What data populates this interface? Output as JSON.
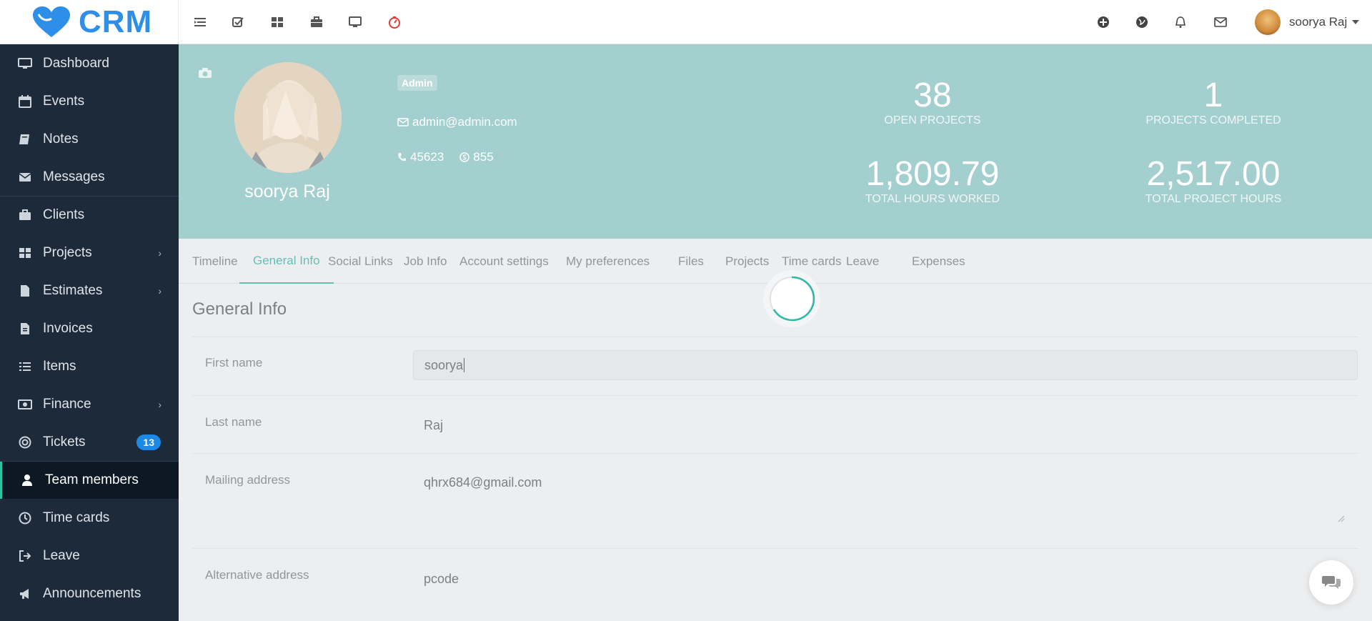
{
  "app": {
    "logo_text": "CRM"
  },
  "topbar": {
    "left_icons": [
      "menu-toggle-icon",
      "todo-checkbox-icon",
      "dashboard-grid-icon",
      "briefcase-icon",
      "monitor-icon",
      "timer-clock-icon"
    ],
    "right_icons": [
      "add-plus-icon",
      "globe-icon",
      "bell-icon",
      "envelope-icon"
    ],
    "user_name": "soorya Raj"
  },
  "sidebar": {
    "items": [
      {
        "label": "Dashboard",
        "icon": "monitor-icon"
      },
      {
        "label": "Events",
        "icon": "calendar-icon"
      },
      {
        "label": "Notes",
        "icon": "book-icon"
      },
      {
        "label": "Messages",
        "icon": "envelope-icon"
      },
      {
        "label": "Clients",
        "icon": "briefcase-icon"
      },
      {
        "label": "Projects",
        "icon": "grid-icon",
        "has_submenu": true
      },
      {
        "label": "Estimates",
        "icon": "file-icon",
        "has_submenu": true
      },
      {
        "label": "Invoices",
        "icon": "file-text-icon"
      },
      {
        "label": "Items",
        "icon": "list-icon"
      },
      {
        "label": "Finance",
        "icon": "money-icon",
        "has_submenu": true
      },
      {
        "label": "Tickets",
        "icon": "life-ring-icon",
        "badge": "13"
      },
      {
        "label": "Team members",
        "icon": "user-icon",
        "active": true
      },
      {
        "label": "Time cards",
        "icon": "clock-icon"
      },
      {
        "label": "Leave",
        "icon": "sign-out-icon"
      },
      {
        "label": "Announcements",
        "icon": "bullhorn-icon"
      }
    ]
  },
  "profile": {
    "name": "soorya Raj",
    "role_badge": "Admin",
    "email": "admin@admin.com",
    "phone": "45623",
    "skype": "855",
    "stats": [
      {
        "value": "38",
        "label": "OPEN PROJECTS"
      },
      {
        "value": "1",
        "label": "PROJECTS COMPLETED"
      },
      {
        "value": "1,809.79",
        "label": "TOTAL HOURS WORKED"
      },
      {
        "value": "2,517.00",
        "label": "TOTAL PROJECT HOURS"
      }
    ]
  },
  "tabs": [
    {
      "label": "Timeline"
    },
    {
      "label": "General Info",
      "active": true
    },
    {
      "label": "Social Links"
    },
    {
      "label": "Job Info"
    },
    {
      "label": "Account settings"
    },
    {
      "label": "My preferences"
    },
    {
      "label": "Files"
    },
    {
      "label": "Projects"
    },
    {
      "label": "Time cards"
    },
    {
      "label": "Leave"
    },
    {
      "label": "Expenses"
    }
  ],
  "general_info": {
    "title": "General Info",
    "fields": [
      {
        "label": "First name",
        "value": "soorya"
      },
      {
        "label": "Last name",
        "value": "Raj"
      },
      {
        "label": "Mailing address",
        "value": "qhrx684@gmail.com"
      },
      {
        "label": "Alternative address",
        "value": "pcode"
      }
    ]
  },
  "colors": {
    "sidebar_bg": "#1c2a3a",
    "header_bg": "#a3cfce",
    "accent": "#2fb9a5",
    "badge_blue": "#1e88e5",
    "logo_blue": "#2e8fe8"
  }
}
